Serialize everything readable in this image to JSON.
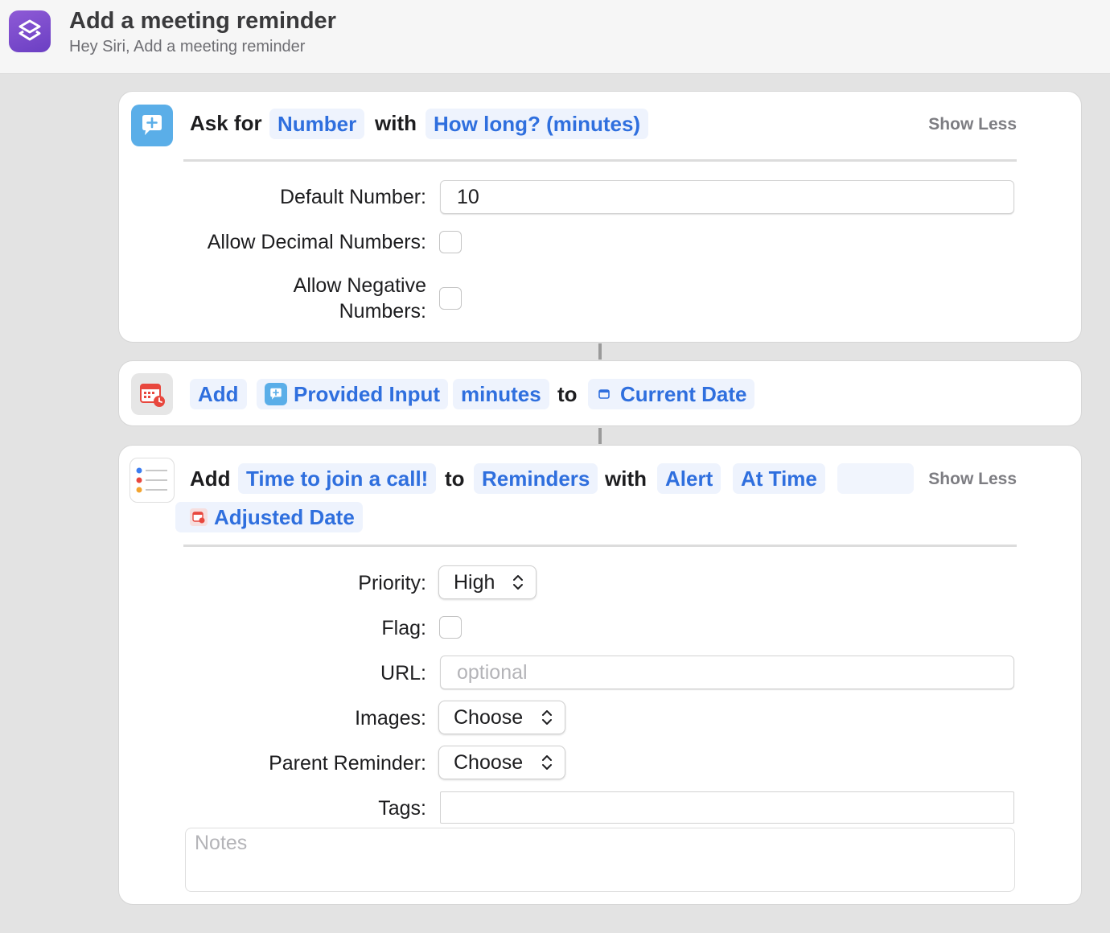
{
  "window": {
    "title": "Add a meeting reminder",
    "subtitle": "Hey Siri, Add a meeting reminder",
    "icon": "shortcuts-stack-icon",
    "accent": "#7a4bcf"
  },
  "actions": {
    "ask": {
      "icon": "speech-bubble-plus-icon",
      "icon_color": "#5aaee8",
      "word_ask_for": "Ask for",
      "token_type": "Number",
      "word_with": "with",
      "token_prompt": "How long? (minutes)",
      "show_less": "Show Less",
      "fields": {
        "default_number_label": "Default Number:",
        "default_number_value": "10",
        "allow_decimal_label": "Allow Decimal Numbers:",
        "allow_decimal_checked": false,
        "allow_negative_label_line1": "Allow Negative",
        "allow_negative_label_line2": "Numbers:",
        "allow_negative_checked": false
      }
    },
    "adjust_date": {
      "icon": "calendar-clock-icon",
      "icon_color": "#e8473d",
      "token_operation": "Add",
      "token_input": "Provided Input",
      "token_unit": "minutes",
      "word_to": "to",
      "token_date": "Current Date"
    },
    "add_reminder": {
      "icon": "reminders-list-icon",
      "word_add": "Add",
      "token_title": "Time to join a call!",
      "word_to": "to",
      "token_list": "Reminders",
      "word_with": "with",
      "token_alert": "Alert",
      "token_at_time": "At Time",
      "token_date": "Adjusted Date",
      "show_less": "Show Less",
      "fields": {
        "priority_label": "Priority:",
        "priority_value": "High",
        "flag_label": "Flag:",
        "flag_checked": false,
        "url_label": "URL:",
        "url_placeholder": "optional",
        "images_label": "Images:",
        "images_value": "Choose",
        "parent_label": "Parent Reminder:",
        "parent_value": "Choose",
        "tags_label": "Tags:",
        "tags_value": "",
        "notes_placeholder": "Notes"
      }
    }
  },
  "colors": {
    "token_text": "#2f6fde",
    "token_bg": "#eef3fd",
    "background": "#e3e3e3"
  }
}
